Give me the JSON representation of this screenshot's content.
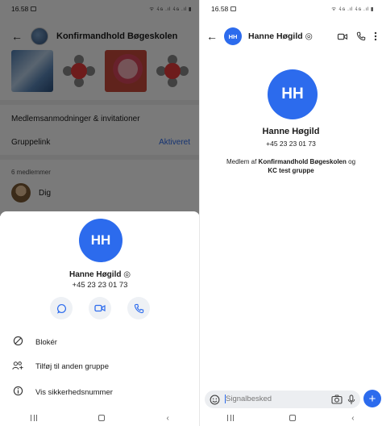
{
  "left": {
    "status": {
      "time": "16.58",
      "icons": "ᯤ 𝟺ɢ .ıl 𝟺ɢ .ıl ▮"
    },
    "header": {
      "title": "Konfirmandhold Bøgeskolen"
    },
    "rows": {
      "requests": "Medlemsanmodninger & invitationer",
      "group_link_label": "Gruppelink",
      "group_link_value": "Aktiveret"
    },
    "members": {
      "count_label": "6 medlemmer",
      "me": "Dig"
    },
    "sheet": {
      "avatar_initials": "HH",
      "name": "Hanne Høgild",
      "phone": "+45 23 23 01 73",
      "menu": [
        {
          "icon": "block-icon",
          "label": "Blokér"
        },
        {
          "icon": "add-to-group-icon",
          "label": "Tilføj til anden gruppe"
        },
        {
          "icon": "info-icon",
          "label": "Vis sikkerhedsnummer"
        }
      ]
    }
  },
  "right": {
    "status": {
      "time": "16.58",
      "icons": "ᯤ 𝟺ɢ .ıl 𝟺ɢ .ıl ▮"
    },
    "header": {
      "avatar_initials": "HH",
      "name": "Hanne Høgild"
    },
    "profile": {
      "avatar_initials": "HH",
      "name": "Hanne Høgild",
      "phone": "+45 23 23 01 73",
      "member_prefix": "Medlem af ",
      "group1": "Konfirmandhold Bøgeskolen",
      "conj": " og",
      "group2": "KC test gruppe"
    },
    "composer": {
      "placeholder": "Signalbesked"
    }
  },
  "colors": {
    "accent": "#2c6bed"
  }
}
